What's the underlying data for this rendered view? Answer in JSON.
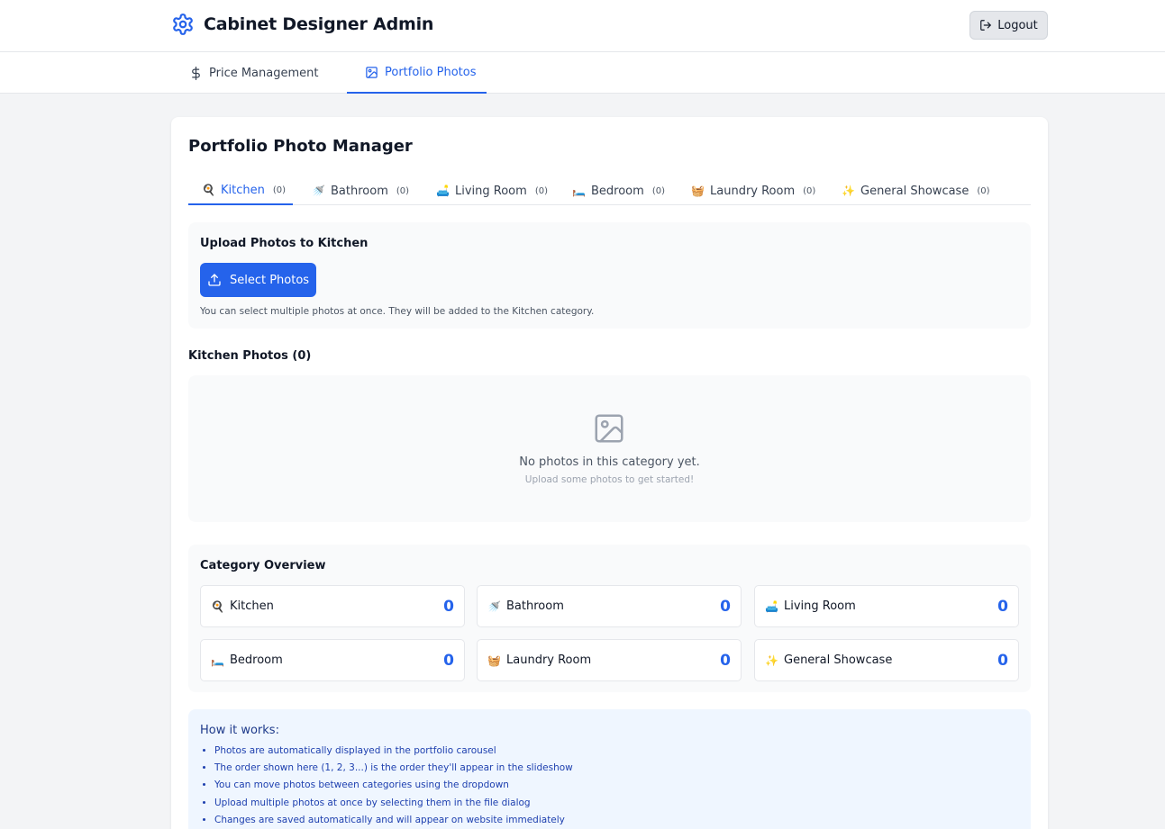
{
  "header": {
    "title": "Cabinet Designer Admin",
    "logout_label": "Logout"
  },
  "nav": {
    "tabs": [
      {
        "label": "Price Management",
        "icon": "dollar-icon",
        "active": false
      },
      {
        "label": "Portfolio Photos",
        "icon": "image-icon",
        "active": true
      }
    ]
  },
  "manager": {
    "title": "Portfolio Photo Manager",
    "categories": [
      {
        "emoji": "🍳",
        "label": "Kitchen",
        "count": "(0)",
        "active": true
      },
      {
        "emoji": "🚿",
        "label": "Bathroom",
        "count": "(0)",
        "active": false
      },
      {
        "emoji": "🛋️",
        "label": "Living Room",
        "count": "(0)",
        "active": false
      },
      {
        "emoji": "🛏️",
        "label": "Bedroom",
        "count": "(0)",
        "active": false
      },
      {
        "emoji": "🧺",
        "label": "Laundry Room",
        "count": "(0)",
        "active": false
      },
      {
        "emoji": "✨",
        "label": "General Showcase",
        "count": "(0)",
        "active": false
      }
    ]
  },
  "upload": {
    "title": "Upload Photos to Kitchen",
    "button_label": "Select Photos",
    "hint": "You can select multiple photos at once. They will be added to the Kitchen category."
  },
  "photos": {
    "title": "Kitchen Photos (0)",
    "empty_main": "No photos in this category yet.",
    "empty_sub": "Upload some photos to get started!"
  },
  "overview": {
    "title": "Category Overview",
    "items": [
      {
        "emoji": "🍳",
        "label": "Kitchen",
        "count": "0"
      },
      {
        "emoji": "🚿",
        "label": "Bathroom",
        "count": "0"
      },
      {
        "emoji": "🛋️",
        "label": "Living Room",
        "count": "0"
      },
      {
        "emoji": "🛏️",
        "label": "Bedroom",
        "count": "0"
      },
      {
        "emoji": "🧺",
        "label": "Laundry Room",
        "count": "0"
      },
      {
        "emoji": "✨",
        "label": "General Showcase",
        "count": "0"
      }
    ]
  },
  "how": {
    "title": "How it works:",
    "items": [
      "Photos are automatically displayed in the portfolio carousel",
      "The order shown here (1, 2, 3...) is the order they'll appear in the slideshow",
      "You can move photos between categories using the dropdown",
      "Upload multiple photos at once by selecting them in the file dialog",
      "Changes are saved automatically and will appear on website immediately"
    ]
  },
  "colors": {
    "accent": "#2563eb",
    "background": "#f3f4f6",
    "info_bg": "#eff6ff"
  }
}
